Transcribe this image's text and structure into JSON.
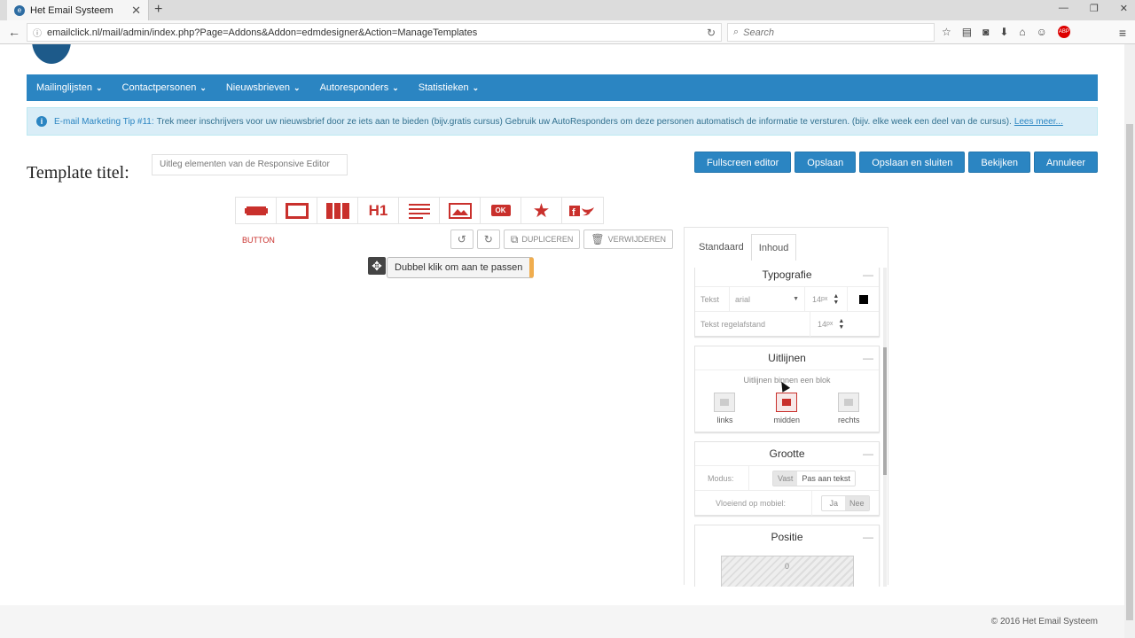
{
  "browser": {
    "tab_title": "Het Email Systeem",
    "url": "emailclick.nl/mail/admin/index.php?Page=Addons&Addon=edmdesigner&Action=ManageTemplates",
    "search_placeholder": "Search"
  },
  "nav": {
    "items": [
      {
        "label": "Mailinglijsten"
      },
      {
        "label": "Contactpersonen"
      },
      {
        "label": "Nieuwsbrieven"
      },
      {
        "label": "Autoresponders"
      },
      {
        "label": "Statistieken"
      }
    ]
  },
  "tip": {
    "label": "E-mail Marketing Tip #11:",
    "text": "Trek meer inschrijvers voor uw nieuwsbrief door ze iets aan te bieden (bijv.gratis cursus) Gebruik uw AutoResponders om deze personen automatisch de informatie te versturen. (bijv. elke week een deel van de cursus).",
    "more": "Lees meer..."
  },
  "template": {
    "title_label": "Template titel:",
    "title_value": "Uitleg elementen van de Responsive Editor"
  },
  "actions": {
    "fullscreen": "Fullscreen editor",
    "save": "Opslaan",
    "save_close": "Opslaan en sluiten",
    "view": "Bekijken",
    "cancel": "Annuleer"
  },
  "blocks": {
    "h1": "H1",
    "ok": "OK"
  },
  "canvas": {
    "selected_label": "BUTTON",
    "duplicate": "DUPLICEREN",
    "delete": "VERWIJDEREN",
    "hint": "Dubbel klik om aan te passen"
  },
  "panel": {
    "tabs": [
      "Standaard",
      "Inhoud"
    ],
    "typografie": {
      "title": "Typografie",
      "text_label": "Tekst",
      "font": "arial",
      "size": "14",
      "unit": "px",
      "line_label": "Tekst regelafstand",
      "line_size": "14",
      "color": "#000000"
    },
    "uitlijnen": {
      "title": "Uitlijnen",
      "sub": "Uitlijnen binnen een blok",
      "options": [
        "links",
        "midden",
        "rechts"
      ],
      "selected": "midden"
    },
    "grootte": {
      "title": "Grootte",
      "mode_label": "Modus:",
      "mode_fixed": "Vast",
      "mode_fit": "Pas aan tekst",
      "fluid_label": "Vloeiend op mobiel:",
      "yes": "Ja",
      "no": "Nee"
    },
    "positie": {
      "title": "Positie",
      "value": "0"
    }
  },
  "footer": {
    "copyright": "© 2016 Het Email Systeem"
  },
  "colors": {
    "nav": "#2b85c2",
    "accent_red": "#c9302c"
  }
}
